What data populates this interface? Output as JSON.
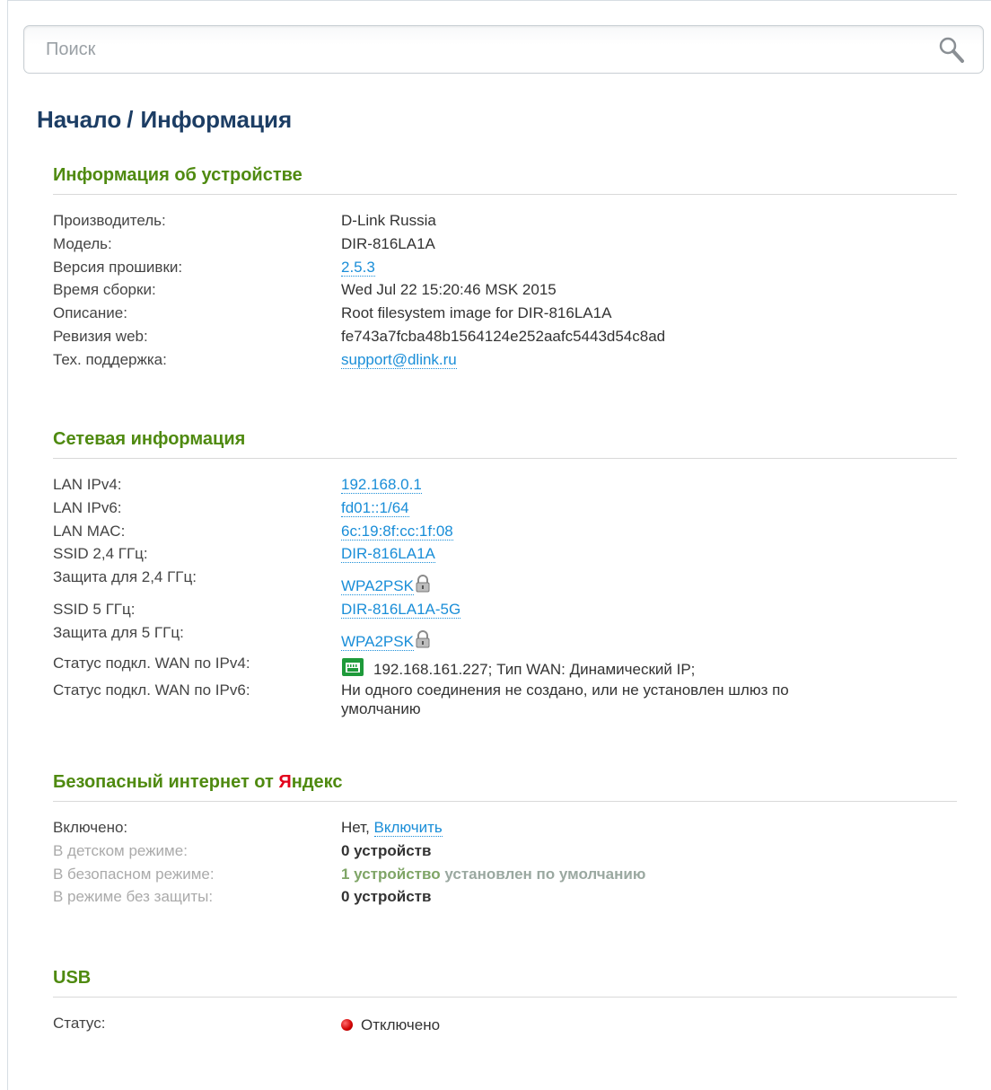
{
  "search": {
    "placeholder": "Поиск"
  },
  "breadcrumb": {
    "home": "Начало",
    "separator": "/",
    "current": "Информация"
  },
  "device": {
    "title": "Информация об устройстве",
    "rows": [
      {
        "label": "Производитель:",
        "value": "D-Link Russia"
      },
      {
        "label": "Модель:",
        "value": "DIR-816LA1A"
      },
      {
        "label": "Версия прошивки:",
        "value": "2.5.3"
      },
      {
        "label": "Время сборки:",
        "value": "Wed Jul 22 15:20:46 MSK 2015"
      },
      {
        "label": "Описание:",
        "value": "Root filesystem image for DIR-816LA1A"
      },
      {
        "label": "Ревизия web:",
        "value": "fe743a7fcba48b1564124e252aafc5443d54c8ad"
      },
      {
        "label": "Тех. поддержка:",
        "value": "support@dlink.ru"
      }
    ]
  },
  "network": {
    "title": "Сетевая информация",
    "rows": [
      {
        "label": "LAN IPv4:",
        "value": "192.168.0.1"
      },
      {
        "label": "LAN IPv6:",
        "value": "fd01::1/64"
      },
      {
        "label": "LAN MAC:",
        "value": "6c:19:8f:cc:1f:08"
      },
      {
        "label": "SSID 2,4 ГГц:",
        "value": "DIR-816LA1A"
      },
      {
        "label": "Защита для 2,4 ГГц:",
        "value": "WPA2PSK"
      },
      {
        "label": "SSID 5 ГГц:",
        "value": "DIR-816LA1A-5G"
      },
      {
        "label": "Защита для 5 ГГц:",
        "value": "WPA2PSK"
      },
      {
        "label": "Статус подкл. WAN по IPv4:",
        "value": "192.168.161.227; Тип WAN: Динамический IP;"
      },
      {
        "label": "Статус подкл. WAN по IPv6:",
        "value": "Ни одного соединения не создано, или не установлен шлюз по умолчанию"
      }
    ]
  },
  "yandex": {
    "title_prefix": "Безопасный интернет от ",
    "title_brand_first": "Я",
    "title_brand_rest": "ндекс",
    "enabled_label": "Включено:",
    "enabled_value": "Нет,",
    "enable_link": "Включить",
    "child_label": "В детском режиме:",
    "child_value": "0 устройств",
    "safe_label": "В безопасном режиме:",
    "safe_value": "1 устройство",
    "safe_note": "установлен по умолчанию",
    "nosec_label": "В режиме без защиты:",
    "nosec_value": "0 устройств"
  },
  "usb": {
    "title": "USB",
    "status_label": "Статус:",
    "status_value": "Отключено",
    "status_color": "#d00000"
  },
  "colors": {
    "section_title": "#4f8a10",
    "breadcrumb": "#1c3d64",
    "link": "#1a8ed8"
  }
}
